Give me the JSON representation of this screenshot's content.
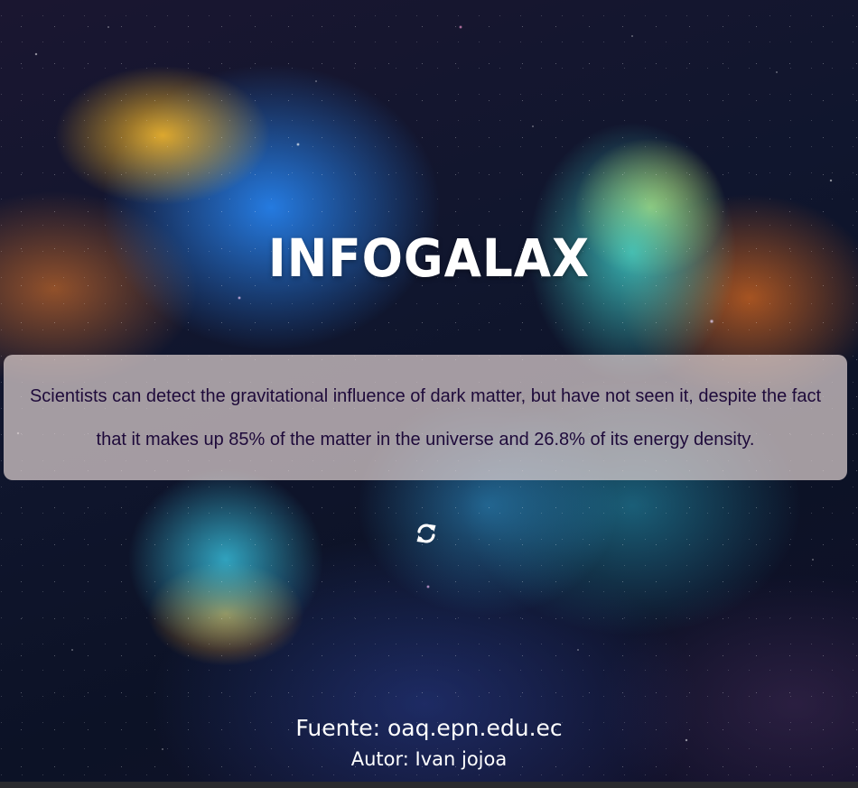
{
  "app": {
    "title": "INFOGALAX"
  },
  "fact": {
    "text": "Scientists can detect the gravitational influence of dark matter, but have not seen it, despite the fact that it makes up 85% of the matter in the universe and 26.8% of its energy density."
  },
  "controls": {
    "refresh_icon": "refresh-icon"
  },
  "footer": {
    "source": "Fuente: oaq.epn.edu.ec",
    "author": "Autor: Ivan jojoa"
  },
  "colors": {
    "title": "#ffffff",
    "fact_box_bg": "#ded0d0",
    "fact_text": "#1e0a3a",
    "footer_text": "#ffffff"
  }
}
